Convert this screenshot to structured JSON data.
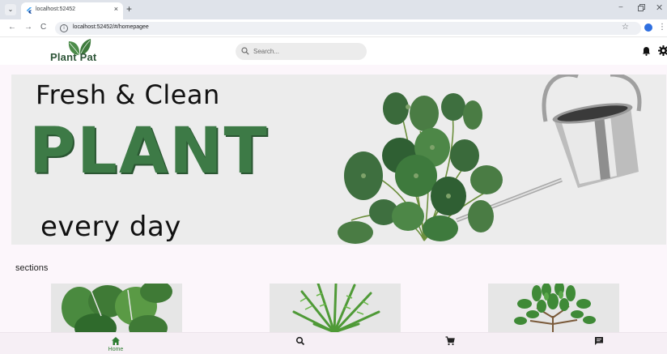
{
  "browser": {
    "tab_title": "localhost:52452",
    "url": "localhost:52452/#/homepagee",
    "new_tab_symbol": "+",
    "tab_close_symbol": "×",
    "minimize_symbol": "−",
    "close_symbol": "✕",
    "back_symbol": "←",
    "forward_symbol": "→",
    "reload_symbol": "C",
    "star_symbol": "☆",
    "menu_symbol": "⋮",
    "info_symbol": "i",
    "tab_dropdown_symbol": "⌄"
  },
  "app": {
    "logo_text": "Plant Pat",
    "search": {
      "placeholder": "Search..."
    },
    "icons": {
      "notifications": "bell-icon",
      "settings": "gear-icon"
    }
  },
  "hero": {
    "line1": "Fresh & Clean",
    "line2": "PLANT",
    "line3": "every day"
  },
  "sections": {
    "title": "sections",
    "cards": [
      {
        "plant": "monstera",
        "icon": "plant-image"
      },
      {
        "plant": "fern",
        "icon": "plant-image"
      },
      {
        "plant": "jade",
        "icon": "plant-image"
      }
    ]
  },
  "bottom_nav": {
    "items": [
      {
        "label": "Home",
        "icon": "home-icon",
        "active": true
      },
      {
        "label": "",
        "icon": "search-icon",
        "active": false
      },
      {
        "label": "",
        "icon": "cart-icon",
        "active": false
      },
      {
        "label": "",
        "icon": "chat-icon",
        "active": false
      }
    ]
  },
  "colors": {
    "brand_green": "#2e7d32",
    "page_background": "#fcf6fb",
    "hero_plant_text": "#3d7a46"
  }
}
